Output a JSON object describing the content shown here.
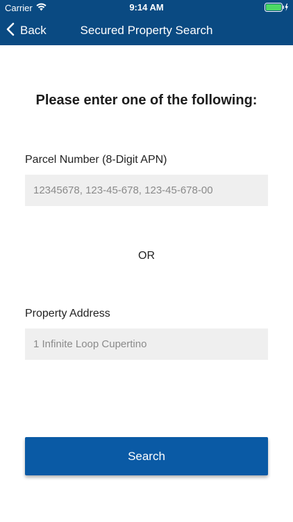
{
  "status_bar": {
    "carrier": "Carrier",
    "time": "9:14 AM"
  },
  "nav": {
    "back_label": "Back",
    "title": "Secured Property Search"
  },
  "form": {
    "prompt": "Please enter one of the following:",
    "parcel_label": "Parcel Number (8-Digit APN)",
    "parcel_placeholder": "12345678, 123-45-678, 123-45-678-00",
    "or_text": "OR",
    "address_label": "Property Address",
    "address_placeholder": "1 Infinite Loop Cupertino",
    "search_label": "Search"
  },
  "colors": {
    "header": "#0a4a82",
    "button": "#0a5aa5",
    "input_bg": "#efefef"
  }
}
